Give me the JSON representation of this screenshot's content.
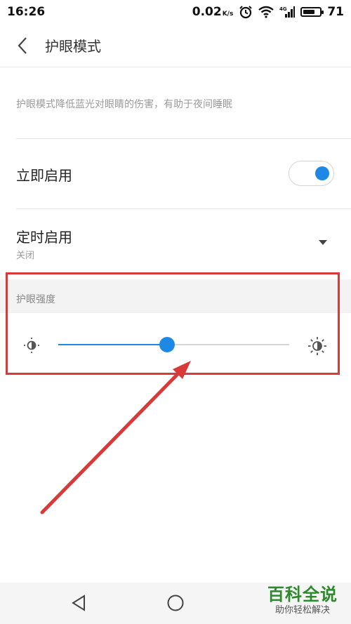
{
  "status_bar": {
    "time": "16:26",
    "speed": "0.02",
    "speed_unit": "K/s",
    "network": "4G",
    "battery": "71",
    "battery_level": 0.71
  },
  "header": {
    "title": "护眼模式",
    "back_icon": "chevron-left-icon"
  },
  "description": "护眼模式降低蓝光对眼睛的伤害，有助于夜间睡眠",
  "instant_enable": {
    "label": "立即启用",
    "toggle_on": true
  },
  "scheduled_enable": {
    "label": "定时启用",
    "value": "关闭"
  },
  "intensity": {
    "section_label": "护眼强度",
    "slider_value": 0.47,
    "min_icon": "dim-sun-icon",
    "max_icon": "bright-sun-icon"
  },
  "colors": {
    "accent": "#1e88e5",
    "highlight": "#d83a3a"
  },
  "nav": {
    "back_icon": "triangle-back-icon",
    "home_icon": "circle-home-icon"
  },
  "watermark": {
    "title": "百科全说",
    "subtitle": "助你轻松解决"
  }
}
